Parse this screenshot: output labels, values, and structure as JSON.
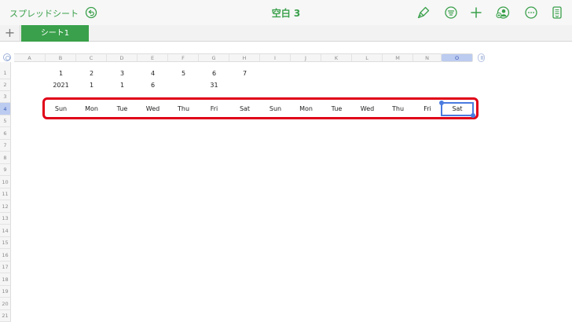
{
  "toolbar": {
    "app_title": "スプレッドシート",
    "doc_title": "空白 3",
    "icons": [
      "undo-icon",
      "paintbrush-icon",
      "format-icon",
      "plus-icon",
      "collaborate-icon",
      "more-icon",
      "document-icon"
    ],
    "accent_color": "#3aa04b"
  },
  "tabs": {
    "add_label": "+",
    "sheets": [
      "シート1"
    ]
  },
  "grid": {
    "columns": [
      "A",
      "B",
      "C",
      "D",
      "E",
      "F",
      "G",
      "H",
      "I",
      "J",
      "K",
      "L",
      "M",
      "N",
      "O"
    ],
    "rows": [
      "1",
      "2",
      "3",
      "4",
      "5",
      "6",
      "7",
      "8",
      "9",
      "10",
      "11",
      "12",
      "13",
      "14",
      "15",
      "16",
      "17",
      "18",
      "19",
      "20",
      "21"
    ],
    "selected_column": "O",
    "selected_row": "4",
    "row1": [
      "1",
      "2",
      "3",
      "4",
      "5",
      "6",
      "7"
    ],
    "row2": [
      "2021",
      "1",
      "1",
      "6",
      "",
      "31"
    ],
    "row4": [
      "Sun",
      "Mon",
      "Tue",
      "Wed",
      "Thu",
      "Fri",
      "Sat",
      "Sun",
      "Mon",
      "Tue",
      "Wed",
      "Thu",
      "Fri",
      "Sat"
    ],
    "highlight_color": "#e00018",
    "selection_color": "#4a7be0"
  }
}
